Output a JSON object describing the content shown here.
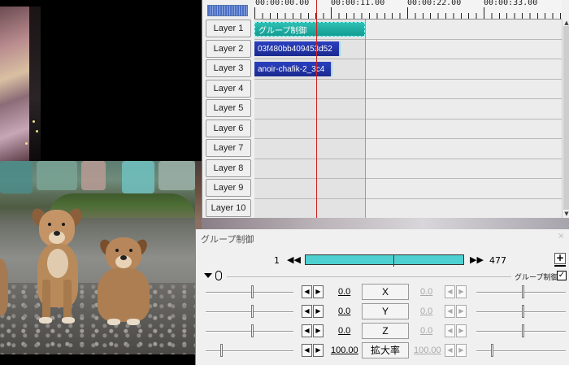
{
  "timeline": {
    "ruler": [
      "00:00:00.00",
      "00:00:11.00",
      "00:00:22.00",
      "00:00:33.00"
    ],
    "layers": [
      "Layer 1",
      "Layer 2",
      "Layer 3",
      "Layer 4",
      "Layer 5",
      "Layer 6",
      "Layer 7",
      "Layer 8",
      "Layer 9",
      "Layer 10"
    ],
    "clips": {
      "group": "グループ制御",
      "media1": "03f480bb409453d52",
      "media2": "anoir-chafik-2_3c4"
    }
  },
  "panel": {
    "title": "グループ制御",
    "frame_start": "1",
    "frame_end": "477",
    "plus": "+",
    "option_label": "グループ制御",
    "checkbox": "✓",
    "seek_prev": "◀◀",
    "seek_next": "▶▶",
    "close": "×",
    "params": [
      {
        "value": "0.0",
        "name": "X",
        "end_value": "0.0"
      },
      {
        "value": "0.0",
        "name": "Y",
        "end_value": "0.0"
      },
      {
        "value": "0.0",
        "name": "Z",
        "end_value": "0.0"
      },
      {
        "value": "100.00",
        "name": "拡大率",
        "end_value": "100.00"
      }
    ]
  }
}
